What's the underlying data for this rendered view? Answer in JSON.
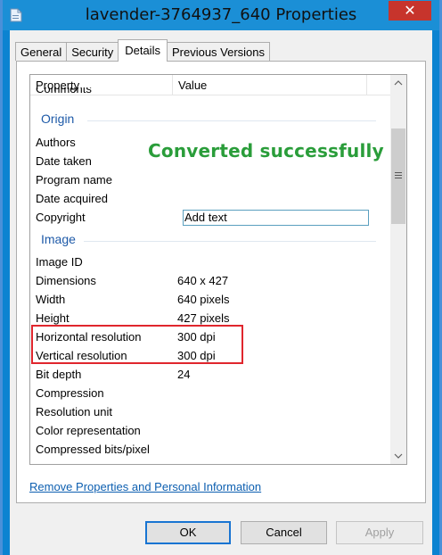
{
  "window": {
    "title": "lavender-3764937_640 Properties",
    "close_glyph": "✕"
  },
  "tabs": [
    {
      "label": "General"
    },
    {
      "label": "Security"
    },
    {
      "label": "Details",
      "active": true
    },
    {
      "label": "Previous Versions"
    }
  ],
  "table": {
    "col_property": "Property",
    "col_value": "Value",
    "partial_row": "Comments"
  },
  "groups": {
    "origin": "Origin",
    "image": "Image"
  },
  "rows": {
    "authors": {
      "property": "Authors",
      "value": ""
    },
    "date_taken": {
      "property": "Date taken",
      "value": ""
    },
    "program_name": {
      "property": "Program name",
      "value": ""
    },
    "date_acquired": {
      "property": "Date acquired",
      "value": ""
    },
    "copyright": {
      "property": "Copyright",
      "value": "Add text"
    },
    "image_id": {
      "property": "Image ID",
      "value": ""
    },
    "dimensions": {
      "property": "Dimensions",
      "value": "640 x 427"
    },
    "width": {
      "property": "Width",
      "value": "640 pixels"
    },
    "height": {
      "property": "Height",
      "value": "427 pixels"
    },
    "horizontal_resolution": {
      "property": "Horizontal resolution",
      "value": "300 dpi"
    },
    "vertical_resolution": {
      "property": "Vertical resolution",
      "value": "300 dpi"
    },
    "bit_depth": {
      "property": "Bit depth",
      "value": "24"
    },
    "compression": {
      "property": "Compression",
      "value": ""
    },
    "resolution_unit": {
      "property": "Resolution unit",
      "value": ""
    },
    "color_representation": {
      "property": "Color representation",
      "value": ""
    },
    "compressed_bits": {
      "property": "Compressed bits/pixel",
      "value": ""
    }
  },
  "overlay_message": "Converted successfully",
  "remove_link": "Remove Properties and Personal Information",
  "buttons": {
    "ok": "OK",
    "cancel": "Cancel",
    "apply": "Apply"
  },
  "icons": {
    "app": "file-properties-icon",
    "scroll_up": "scroll-up-arrow-icon",
    "scroll_down": "scroll-down-arrow-icon",
    "grip": "scrollbar-grip-icon"
  },
  "colors": {
    "title_bar": "#1b8fd6",
    "close_button": "#c7342c",
    "group_heading": "#1e5aa8",
    "overlay_message": "#2a9d3a",
    "highlight_box": "#e0262d",
    "link": "#0d5fb0"
  }
}
